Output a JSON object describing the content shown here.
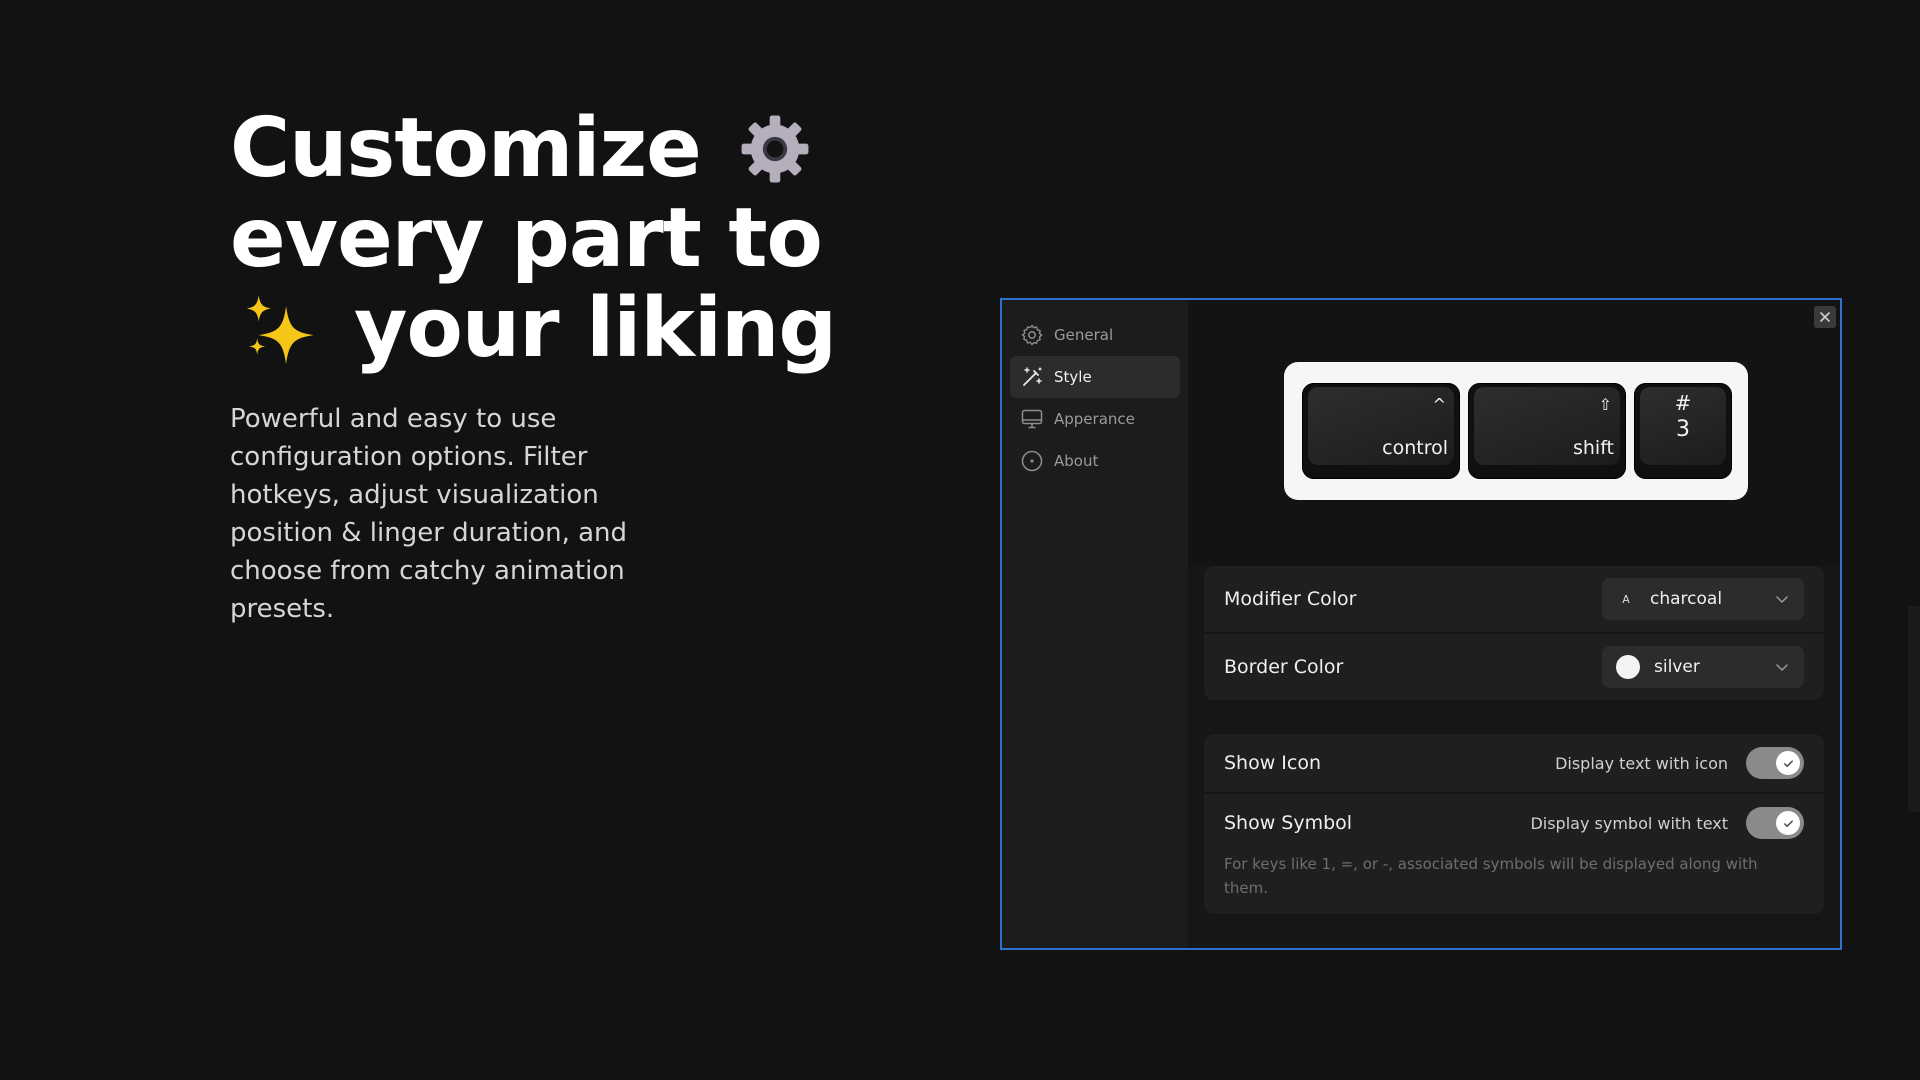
{
  "hero": {
    "line1": "Customize",
    "line2": "every part to",
    "line3": "your liking",
    "description": "Powerful and easy to use configuration options. Filter hotkeys, adjust visualization position & linger duration, and choose from catchy animation presets."
  },
  "sidebar": {
    "items": [
      {
        "label": "General",
        "icon": "gear-icon"
      },
      {
        "label": "Style",
        "icon": "magic-wand-icon",
        "active": true
      },
      {
        "label": "Apperance",
        "icon": "monitor-icon"
      },
      {
        "label": "About",
        "icon": "info-circle-icon"
      }
    ]
  },
  "preview": {
    "keys": [
      {
        "label": "control",
        "symbol": "^"
      },
      {
        "label": "shift",
        "symbol": "⇧"
      },
      {
        "hash": "#",
        "digit": "3"
      }
    ]
  },
  "settings": {
    "modifier_color": {
      "label": "Modifier Color",
      "swatch": "A",
      "value": "charcoal"
    },
    "border_color": {
      "label": "Border Color",
      "value": "silver"
    },
    "show_icon": {
      "label": "Show Icon",
      "description": "Display text with icon",
      "enabled": true
    },
    "show_symbol": {
      "label": "Show Symbol",
      "description": "Display symbol with text",
      "enabled": true
    },
    "note": "For keys like 1, =, or -, associated symbols will be displayed along with them."
  },
  "colors": {
    "background": "#121212",
    "window_border": "#2f6fd0",
    "toggle_on": "#8a8a8a"
  }
}
